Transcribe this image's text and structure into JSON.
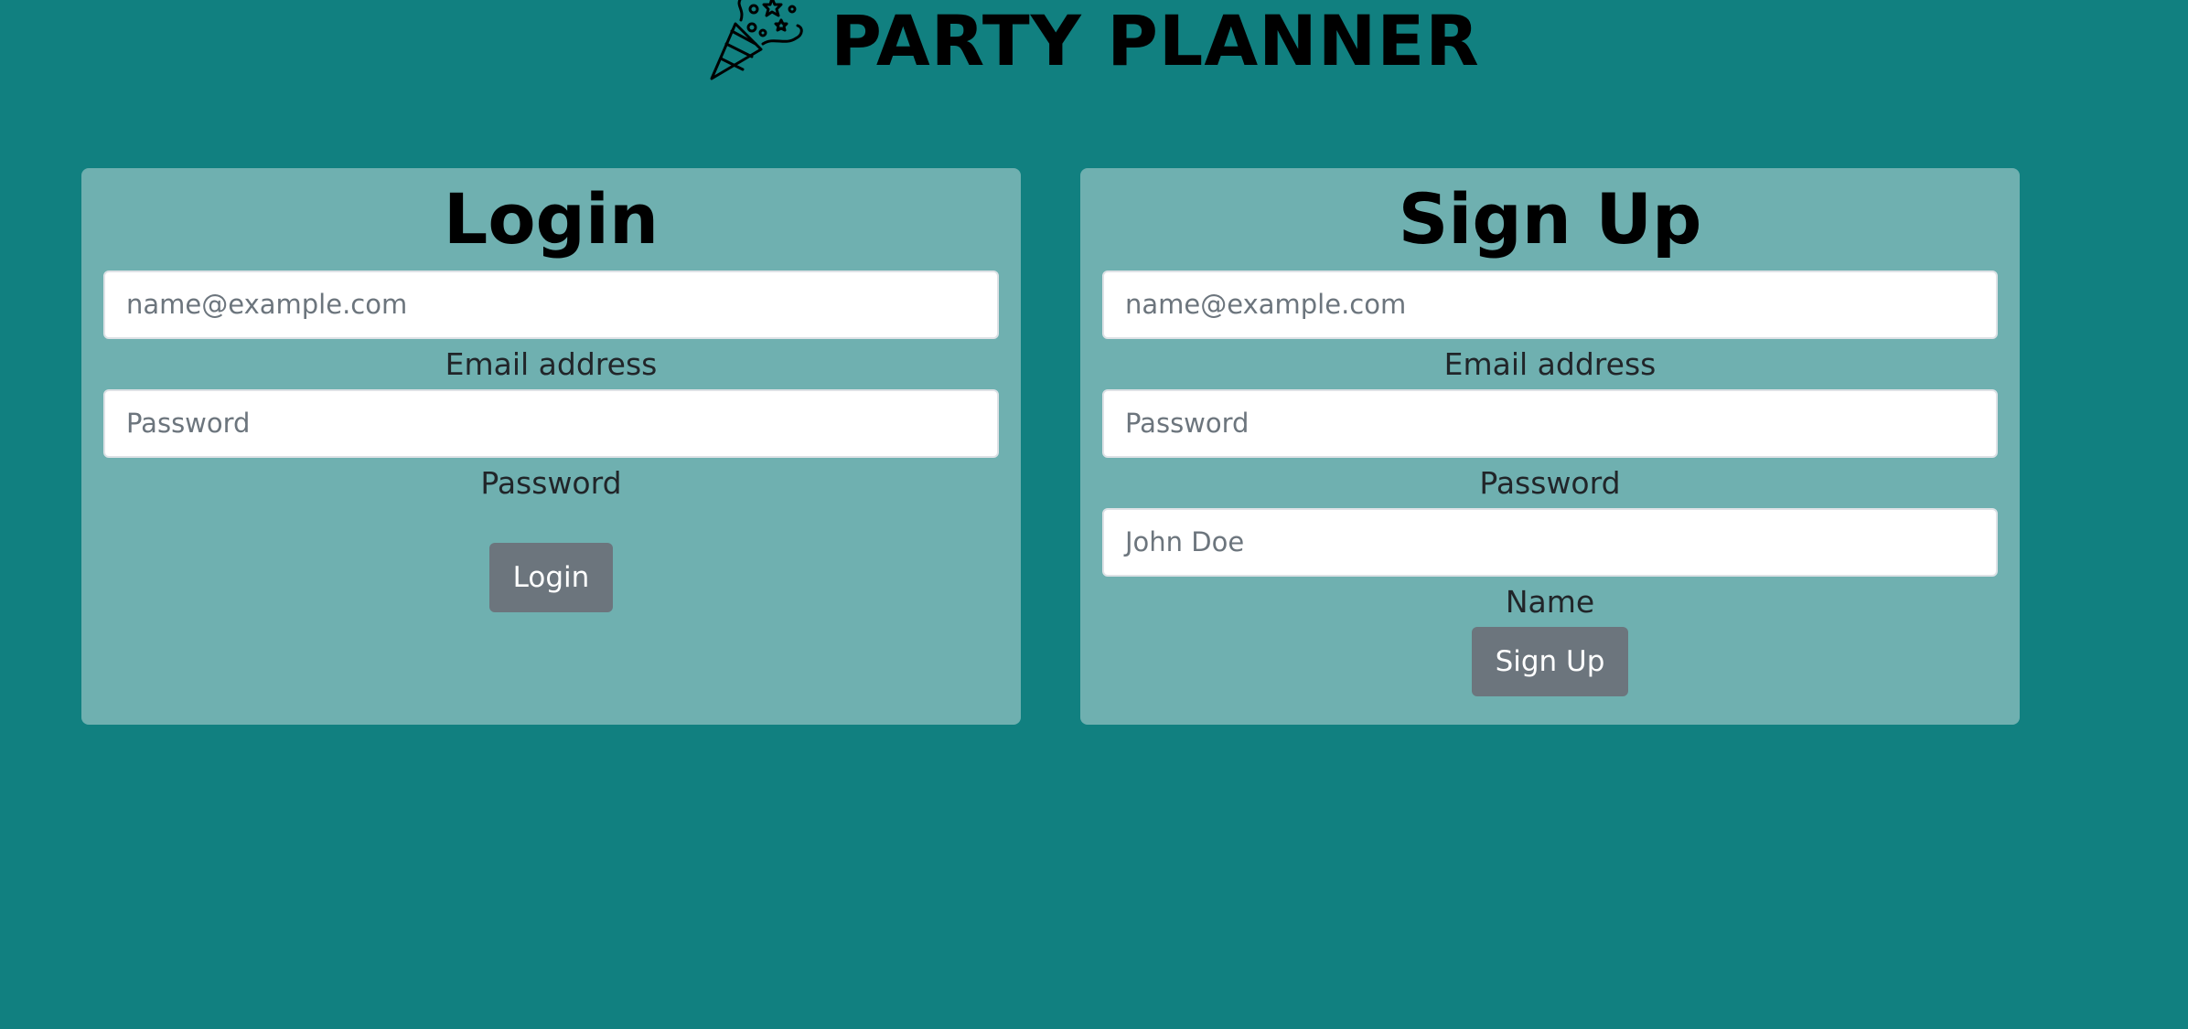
{
  "header": {
    "title": "PARTY PLANNER",
    "icon": "party-popper-icon"
  },
  "login": {
    "title": "Login",
    "email": {
      "placeholder": "name@example.com",
      "label": "Email address"
    },
    "password": {
      "placeholder": "Password",
      "label": "Password"
    },
    "button_label": "Login"
  },
  "signup": {
    "title": "Sign Up",
    "email": {
      "placeholder": "name@example.com",
      "label": "Email address"
    },
    "password": {
      "placeholder": "Password",
      "label": "Password"
    },
    "name": {
      "placeholder": "John Doe",
      "label": "Name"
    },
    "button_label": "Sign Up"
  },
  "colors": {
    "background": "#118080",
    "card": "#6fb0b0",
    "button": "#6c757d"
  }
}
